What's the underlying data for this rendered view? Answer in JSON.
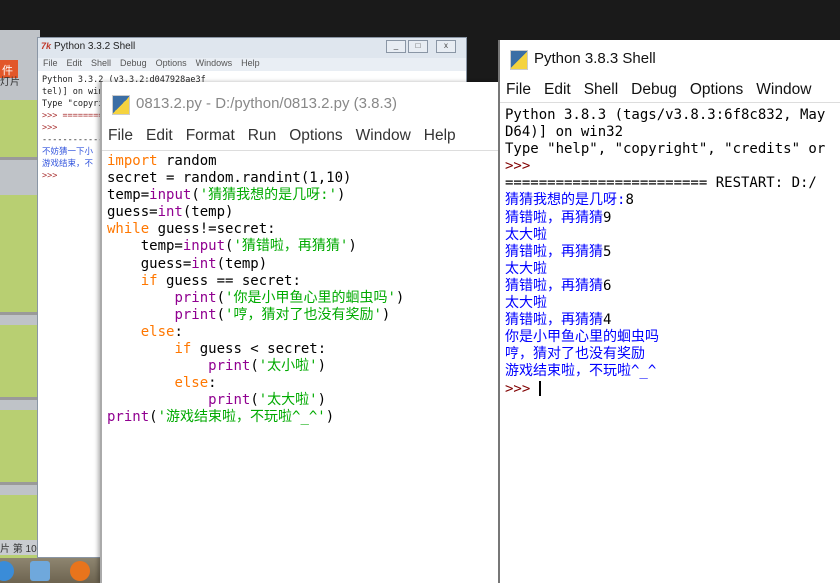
{
  "background_app": {
    "file_tab": "件",
    "slides_tab": "灯片",
    "status": "片 第 10"
  },
  "old_shell": {
    "title": "Python 3.3.2 Shell",
    "menu": [
      "File",
      "Edit",
      "Shell",
      "Debug",
      "Options",
      "Windows",
      "Help"
    ],
    "lines": [
      "Python 3.3.2 (v3.3.2:d047928ae3f",
      "tel)] on win",
      "Type \"copyri",
      ">>> ========",
      "",
      ">>>",
      "------------",
      "不妨猜一下小",
      "游戏结束，不",
      ">>>"
    ]
  },
  "editor": {
    "title": "0813.2.py - D:/python/0813.2.py (3.8.3)",
    "menu": [
      "File",
      "Edit",
      "Format",
      "Run",
      "Options",
      "Window",
      "Help"
    ],
    "code": [
      [
        [
          "kw",
          "import"
        ],
        [
          "tx",
          " random"
        ]
      ],
      [
        [
          "tx",
          "secret = random.randint(1,10)"
        ]
      ],
      [
        [
          "tx",
          "temp="
        ],
        [
          "bi",
          "input"
        ],
        [
          "tx",
          "("
        ],
        [
          "st",
          "'猜猜我想的是几呀:'"
        ],
        [
          "tx",
          ")"
        ]
      ],
      [
        [
          "tx",
          "guess="
        ],
        [
          "bi",
          "int"
        ],
        [
          "tx",
          "(temp)"
        ]
      ],
      [
        [
          "kw",
          "while"
        ],
        [
          "tx",
          " guess!=secret:"
        ]
      ],
      [
        [
          "tx",
          "    temp="
        ],
        [
          "bi",
          "input"
        ],
        [
          "tx",
          "("
        ],
        [
          "st",
          "'猜错啦，再猜猜'"
        ],
        [
          "tx",
          ")"
        ]
      ],
      [
        [
          "tx",
          "    guess="
        ],
        [
          "bi",
          "int"
        ],
        [
          "tx",
          "(temp)"
        ]
      ],
      [
        [
          "tx",
          "    "
        ],
        [
          "kw",
          "if"
        ],
        [
          "tx",
          " guess == secret:"
        ]
      ],
      [
        [
          "tx",
          "        "
        ],
        [
          "bi",
          "print"
        ],
        [
          "tx",
          "("
        ],
        [
          "st",
          "'你是小甲鱼心里的蛔虫吗'"
        ],
        [
          "tx",
          ")"
        ]
      ],
      [
        [
          "tx",
          "        "
        ],
        [
          "bi",
          "print"
        ],
        [
          "tx",
          "("
        ],
        [
          "st",
          "'哼，猜对了也没有奖励'"
        ],
        [
          "tx",
          ")"
        ]
      ],
      [
        [
          "tx",
          "    "
        ],
        [
          "kw",
          "else"
        ],
        [
          "tx",
          ":"
        ]
      ],
      [
        [
          "tx",
          "        "
        ],
        [
          "kw",
          "if"
        ],
        [
          "tx",
          " guess < secret:"
        ]
      ],
      [
        [
          "tx",
          "            "
        ],
        [
          "bi",
          "print"
        ],
        [
          "tx",
          "("
        ],
        [
          "st",
          "'太小啦'"
        ],
        [
          "tx",
          ")"
        ]
      ],
      [
        [
          "tx",
          "        "
        ],
        [
          "kw",
          "else"
        ],
        [
          "tx",
          ":"
        ]
      ],
      [
        [
          "tx",
          "            "
        ],
        [
          "bi",
          "print"
        ],
        [
          "tx",
          "("
        ],
        [
          "st",
          "'太大啦'"
        ],
        [
          "tx",
          ")"
        ]
      ],
      [
        [
          "bi",
          "print"
        ],
        [
          "tx",
          "("
        ],
        [
          "st",
          "'游戏结束啦，不玩啦^_^'"
        ],
        [
          "tx",
          ")"
        ]
      ]
    ]
  },
  "shell": {
    "title": "Python 3.8.3 Shell",
    "menu": [
      "File",
      "Edit",
      "Shell",
      "Debug",
      "Options",
      "Window"
    ],
    "lines": [
      [
        [
          "tx",
          "Python 3.8.3 (tags/v3.8.3:6f8c832, May"
        ]
      ],
      [
        [
          "tx",
          "D64)] on win32"
        ]
      ],
      [
        [
          "tx",
          "Type \"help\", \"copyright\", \"credits\" or"
        ]
      ],
      [
        [
          "pr",
          ">>>"
        ]
      ],
      [
        [
          "tx",
          "======================== RESTART: D:/"
        ]
      ],
      [
        [
          "out",
          "猜猜我想的是几呀:"
        ],
        [
          "in",
          "8"
        ]
      ],
      [
        [
          "out",
          "猜错啦，再猜猜"
        ],
        [
          "in",
          "9"
        ]
      ],
      [
        [
          "out",
          "太大啦"
        ]
      ],
      [
        [
          "out",
          "猜错啦，再猜猜"
        ],
        [
          "in",
          "5"
        ]
      ],
      [
        [
          "out",
          "太大啦"
        ]
      ],
      [
        [
          "out",
          "猜错啦，再猜猜"
        ],
        [
          "in",
          "6"
        ]
      ],
      [
        [
          "out",
          "太大啦"
        ]
      ],
      [
        [
          "out",
          "猜错啦，再猜猜"
        ],
        [
          "in",
          "4"
        ]
      ],
      [
        [
          "out",
          "你是小甲鱼心里的蛔虫吗"
        ]
      ],
      [
        [
          "out",
          "哼，猜对了也没有奖励"
        ]
      ],
      [
        [
          "out",
          "游戏结束啦，不玩啦^_^"
        ]
      ],
      [
        [
          "pr",
          ">>> "
        ]
      ]
    ]
  },
  "colors": {
    "keyword": "#ff7700",
    "builtin": "#900090",
    "string": "#00aa00",
    "stdout": "#0000ff",
    "prompt": "#800000"
  }
}
